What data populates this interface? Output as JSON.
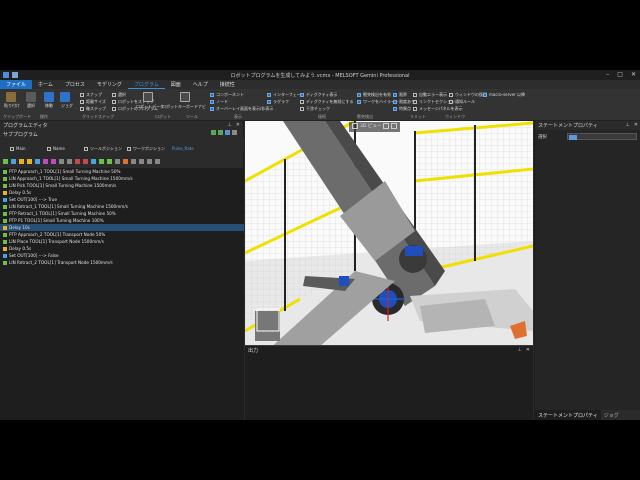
{
  "window": {
    "title": "ロボットプログラムを生成してみよう.vcmx - MELSOFT Gemini Professional"
  },
  "menu": [
    "ファイル",
    "ホーム",
    "プロセス",
    "モデリング",
    "プログラム",
    "図面",
    "ヘルプ",
    "接続性"
  ],
  "ribbon": {
    "left_buttons": [
      "貼り付け",
      "選択",
      "移動",
      "ジョグ"
    ],
    "left_labels": [
      "クリップボード",
      "操作"
    ],
    "snap": {
      "items": [
        "スナップ",
        "距離サイズ",
        "軸ステップ"
      ],
      "checkbox": "軸拡大"
    },
    "workspace_label": "グリッドステップ",
    "robot_buttons": [
      "選択",
      "ロボットをスナップ",
      "ロボットのプログラム"
    ],
    "robot_label": "ロボット",
    "tools": [
      "ロボットデータ",
      "ロボットキーボードナビ"
    ],
    "tools_label": "ツール",
    "display_items": [
      "コンポーネント",
      "ノード",
      "オーバーレイ画面を表示/非表示",
      "インターフェース",
      "ラグラフ"
    ],
    "display_label": "表示",
    "connect_items": [
      "ディグクティ表示",
      "ディグクティを無効にする",
      "干渉チェック"
    ],
    "connect_label": "接続",
    "collision_items": [
      "衝突検出を有効",
      "ワークをハイライト"
    ],
    "collision_label": "衝突検出",
    "limit_items": [
      "限界",
      "限度あり",
      "特異点"
    ],
    "limit_label": "リミット",
    "error_items": [
      "自動エラー表示",
      "リンクトセクション",
      "メッセージパネルを表示"
    ],
    "error_label": "ウィンドウ",
    "window_items": [
      "ウィンドウの復元",
      "通知ルール"
    ],
    "extra_button": "macro-server 以降"
  },
  "program_editor": {
    "title": "プログラムエディタ",
    "subprogram_label": "サブプログラム",
    "columns": [
      "Main",
      "Name",
      "ツールポジション",
      "ワークポジション",
      "Pulse_Rate"
    ],
    "rows": [
      {
        "text": "PTP Approach_1 TOOL[1] Small Turning Machine 50%",
        "color": "#6cc04a"
      },
      {
        "text": "LIN Approach_1 TOOL[1] Small Turning Machine 1500mm/s",
        "color": "#6cc04a"
      },
      {
        "text": "LIN Pick TOOL[1] Small Turning Machine 1500mm/s",
        "color": "#6cc04a"
      },
      {
        "text": "Delay 0.5s",
        "color": "#e6b422"
      },
      {
        "text": "Set OUT[100] ---> True",
        "color": "#4aa3df"
      },
      {
        "text": "LIN Retract_1 TOOL[1] Small Turning Machine 1500mm/s",
        "color": "#6cc04a"
      },
      {
        "text": "PTP Retract_1 TOOL[1] Small Turning Machine 50%",
        "color": "#6cc04a"
      },
      {
        "text": "PTP P1 TOOL[1] Small Turning Machine 100%",
        "color": "#6cc04a"
      },
      {
        "text": "Delay 10s",
        "color": "#e6b422"
      },
      {
        "text": "PTP Approach_2 TOOL[1] Transport Node 50%",
        "color": "#6cc04a"
      },
      {
        "text": "LIN Place TOOL[1] Transport Node 1500mm/s",
        "color": "#6cc04a"
      },
      {
        "text": "Delay 0.5s",
        "color": "#e6b422"
      },
      {
        "text": "Set OUT[100] ---> False",
        "color": "#4aa3df"
      },
      {
        "text": "LIN Retract_2 TOOL[1] Transport Node 1500mm/s",
        "color": "#6cc04a"
      }
    ],
    "selected_index": 8
  },
  "viewport": {
    "toolbar_label": "3D ビュー"
  },
  "output": {
    "title": "出力"
  },
  "statement_props": {
    "title": "ステートメントプロパティ",
    "field_label": "選択",
    "tabs": [
      "ステートメントプロパティ",
      "ジョグ"
    ]
  },
  "colors": {
    "accent": "#1e6fc2",
    "yellow": "#f0e000",
    "selection": "#264f78"
  }
}
